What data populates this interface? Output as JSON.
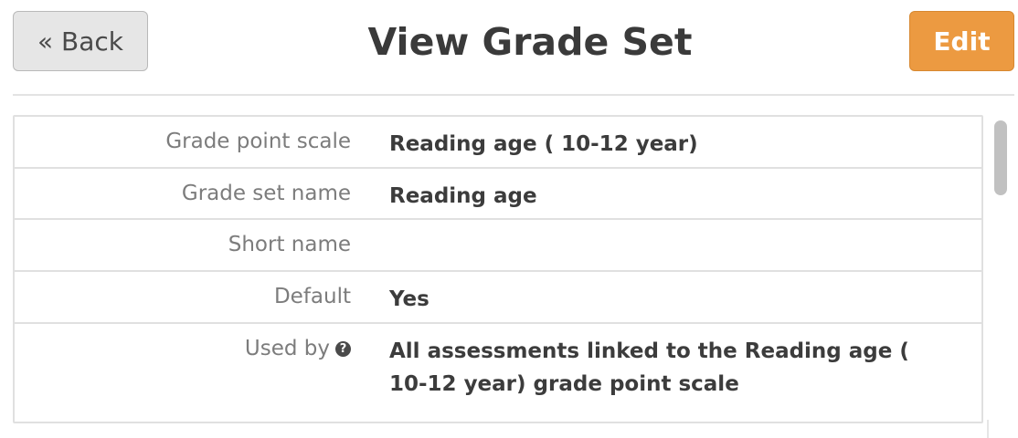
{
  "header": {
    "back_label": "« Back",
    "title": "View Grade Set",
    "edit_label": "Edit"
  },
  "colors": {
    "edit_button": "#ec9a41",
    "back_button": "#e6e6e6",
    "label_text": "#7c7c7c",
    "value_text": "#3c3c3c"
  },
  "details": [
    {
      "label": "Grade point scale",
      "value": "Reading age ( 10-12 year)"
    },
    {
      "label": "Grade set name",
      "value": "Reading age"
    },
    {
      "label": "Short name",
      "value": ""
    },
    {
      "label": "Default",
      "value": "Yes"
    },
    {
      "label": "Used by",
      "value": "All assessments linked to the Reading age ( 10-12 year) grade point scale",
      "icon": "help-icon",
      "icon_glyph": "?"
    }
  ]
}
